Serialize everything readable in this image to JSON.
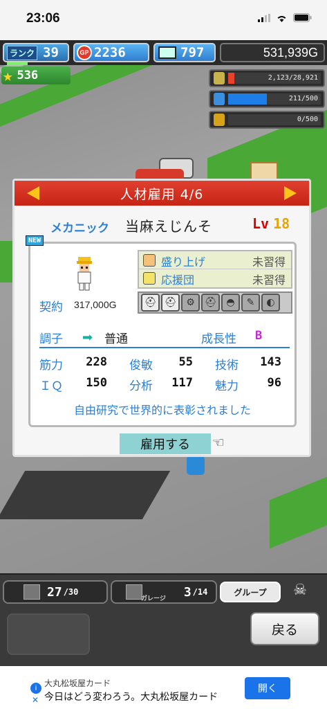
{
  "status_bar": {
    "time": "23:06"
  },
  "hud": {
    "rank_label": "ランク",
    "rank": "39",
    "gp_icon_label": "GP",
    "gp": "2236",
    "computers": "797",
    "money": "531,939G",
    "stars": "536",
    "resources": [
      {
        "icon": "oil-barrel-icon",
        "value": "2,123/28,921",
        "fill_ratio": 0.07,
        "color": "#e8432a"
      },
      {
        "icon": "water-bottle-icon",
        "value": "211/500",
        "fill_ratio": 0.42,
        "color": "#1e7ee8"
      },
      {
        "icon": "wheat-icon",
        "value": "0/500",
        "fill_ratio": 0.0,
        "color": "#d6a21a"
      }
    ]
  },
  "dialog": {
    "title": "人材雇用 4/6",
    "job": "メカニック",
    "name": "当麻えじんそ",
    "lv_label": "Lv",
    "lv": "18",
    "new_badge": "NEW",
    "contract_label": "契約",
    "contract_value": "317,000G",
    "skills": [
      {
        "icon": "cheer-face-icon",
        "name": "盛り上げ",
        "state": "未習得"
      },
      {
        "icon": "megaphone-icon",
        "name": "応援団",
        "state": "未習得"
      }
    ],
    "equipment_icons": [
      "helmet-icon",
      "helmet-icon",
      "gear-icon",
      "helmet-icon",
      "cap-icon",
      "wrench-icon",
      "tire-icon"
    ],
    "condition_label": "調子",
    "condition_value": "普通",
    "growth_label": "成長性",
    "growth_value": "B",
    "stats": [
      {
        "label": "筋力",
        "value": "228"
      },
      {
        "label": "俊敏",
        "value": "55"
      },
      {
        "label": "技術",
        "value": "143"
      },
      {
        "label": "ＩＱ",
        "value": "150"
      },
      {
        "label": "分析",
        "value": "117"
      },
      {
        "label": "魅力",
        "value": "96"
      }
    ],
    "bio": "自由研究で世界的に表彰されました",
    "hire_label": "雇用する"
  },
  "toolbar": {
    "staff_count": "27",
    "staff_max": "/30",
    "garage_label": "ガレージ",
    "garage_count": "3",
    "garage_max": "/14",
    "group_label": "グループ",
    "back_label": "戻る"
  },
  "ad": {
    "advertiser": "大丸松坂屋カード",
    "text": "今日はどう変わろう。大丸松坂屋カード",
    "button": "開く"
  }
}
